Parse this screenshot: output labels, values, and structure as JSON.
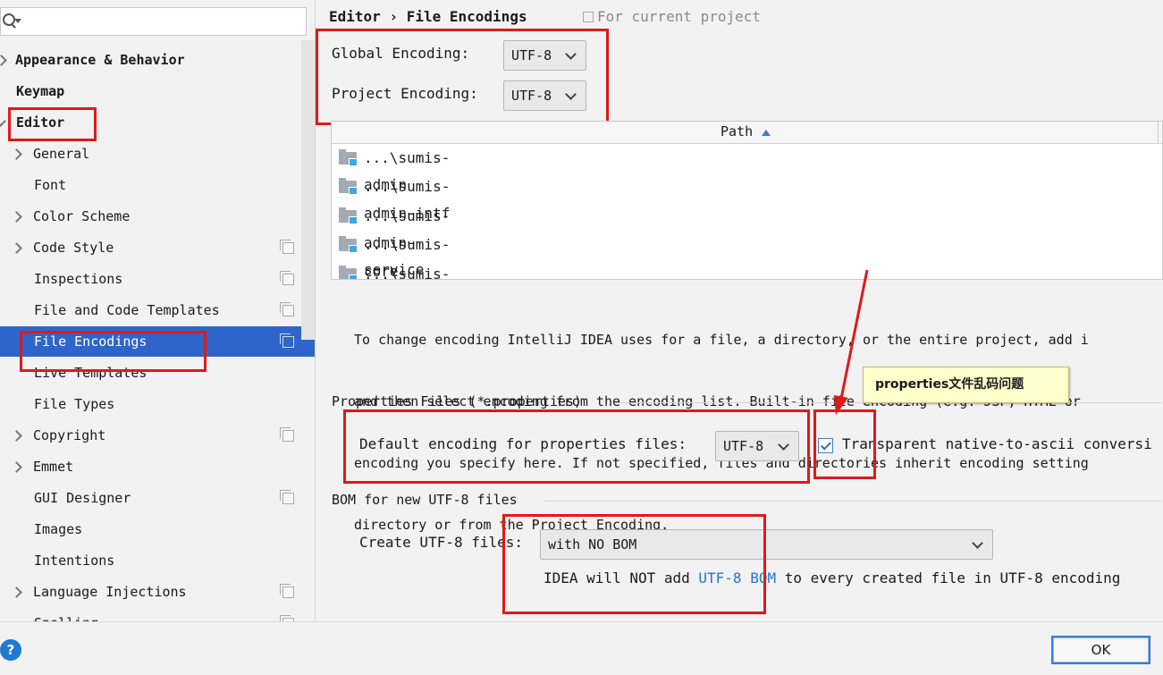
{
  "search": {
    "placeholder": ""
  },
  "sidebar": {
    "items": [
      {
        "label": "Appearance & Behavior"
      },
      {
        "label": "Keymap"
      },
      {
        "label": "Editor"
      },
      {
        "label": "General"
      },
      {
        "label": "Font"
      },
      {
        "label": "Color Scheme"
      },
      {
        "label": "Code Style"
      },
      {
        "label": "Inspections"
      },
      {
        "label": "File and Code Templates"
      },
      {
        "label": "File Encodings"
      },
      {
        "label": "Live Templates"
      },
      {
        "label": "File Types"
      },
      {
        "label": "Copyright"
      },
      {
        "label": "Emmet"
      },
      {
        "label": "GUI Designer"
      },
      {
        "label": "Images"
      },
      {
        "label": "Intentions"
      },
      {
        "label": "Language Injections"
      },
      {
        "label": "Spelling"
      }
    ]
  },
  "breadcrumb": {
    "parent": "Editor",
    "separator": "›",
    "current": "File Encodings",
    "scope": "For current project"
  },
  "encoding": {
    "global_label": "Global Encoding:",
    "global_value": "UTF-8",
    "project_label": "Project Encoding:",
    "project_value": "UTF-8"
  },
  "table": {
    "header": "Path",
    "rows": [
      "...\\sumis-admin",
      "...\\sumis-admin-intf",
      "...\\sumis-admin-service",
      "...\\sumis-core",
      "...\\sumis-interface"
    ]
  },
  "help": {
    "lines": [
      "To change encoding IntelliJ IDEA uses for a file, a directory, or the entire project, add i",
      "and then select encoding from the encoding list. Built-in file encoding (e.g. JSP, HTML or",
      "encoding you specify here. If not specified, files and directories inherit encoding setting",
      "directory or from the Project Encoding."
    ]
  },
  "properties": {
    "section_title": "Properties Files (*.properties)",
    "default_label": "Default encoding for properties files:",
    "default_value": "UTF-8",
    "transparent_label": "Transparent native-to-ascii conversi",
    "transparent_checked": true
  },
  "annotation": {
    "callout": "properties文件乱码问题"
  },
  "bom": {
    "section_title": "BOM for new UTF-8 files",
    "create_label": "Create UTF-8 files:",
    "create_value": "with NO BOM",
    "note_prefix": "IDEA will NOT add ",
    "note_link": "UTF-8 BOM",
    "note_suffix": " to every created file in UTF-8 encoding"
  },
  "footer": {
    "help": "?",
    "ok": "OK"
  },
  "colors": {
    "selection": "#2f65ca",
    "highlight_box": "#e01919",
    "link": "#2675d1"
  }
}
